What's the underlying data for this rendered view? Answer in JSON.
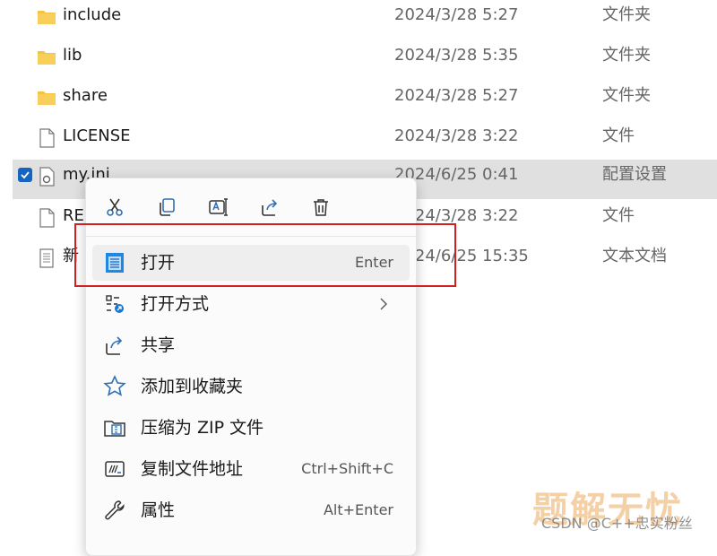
{
  "files": [
    {
      "name": "include",
      "date": "2024/3/28 5:27",
      "type": "文件夹",
      "icon": "folder-icon"
    },
    {
      "name": "lib",
      "date": "2024/3/28 5:35",
      "type": "文件夹",
      "icon": "folder-icon"
    },
    {
      "name": "share",
      "date": "2024/3/28 5:27",
      "type": "文件夹",
      "icon": "folder-icon"
    },
    {
      "name": "LICENSE",
      "date": "2024/3/28 3:22",
      "type": "文件",
      "icon": "file-icon"
    },
    {
      "name": "my.ini",
      "date": "2024/6/25 0:41",
      "type": "配置设置",
      "icon": "settings-file-icon",
      "selected": true
    },
    {
      "name": "RE",
      "date": "2024/3/28 3:22",
      "type": "文件",
      "icon": "file-icon"
    },
    {
      "name": "新",
      "date": "2024/6/25 15:35",
      "type": "文本文档",
      "icon": "text-file-icon"
    }
  ],
  "context_menu": {
    "quick_actions": [
      "cut-icon",
      "copy-icon",
      "rename-icon",
      "share-icon",
      "delete-icon"
    ],
    "items": [
      {
        "label": "打开",
        "shortcut": "Enter",
        "icon": "notepad-icon"
      },
      {
        "label": "打开方式",
        "shortcut": "",
        "icon": "open-with-icon",
        "submenu": true
      },
      {
        "label": "共享",
        "shortcut": "",
        "icon": "share-icon"
      },
      {
        "label": "添加到收藏夹",
        "shortcut": "",
        "icon": "star-icon"
      },
      {
        "label": "压缩为 ZIP 文件",
        "shortcut": "",
        "icon": "zip-icon"
      },
      {
        "label": "复制文件地址",
        "shortcut": "Ctrl+Shift+C",
        "icon": "copy-path-icon"
      },
      {
        "label": "属性",
        "shortcut": "Alt+Enter",
        "icon": "wrench-icon"
      }
    ]
  },
  "watermark": {
    "logo": "题解无忧",
    "text": "CSDN @C++忠实粉丝"
  },
  "colors": {
    "folder": "#f5c242",
    "accent": "#1565c0",
    "highlight_box": "#d02020"
  }
}
